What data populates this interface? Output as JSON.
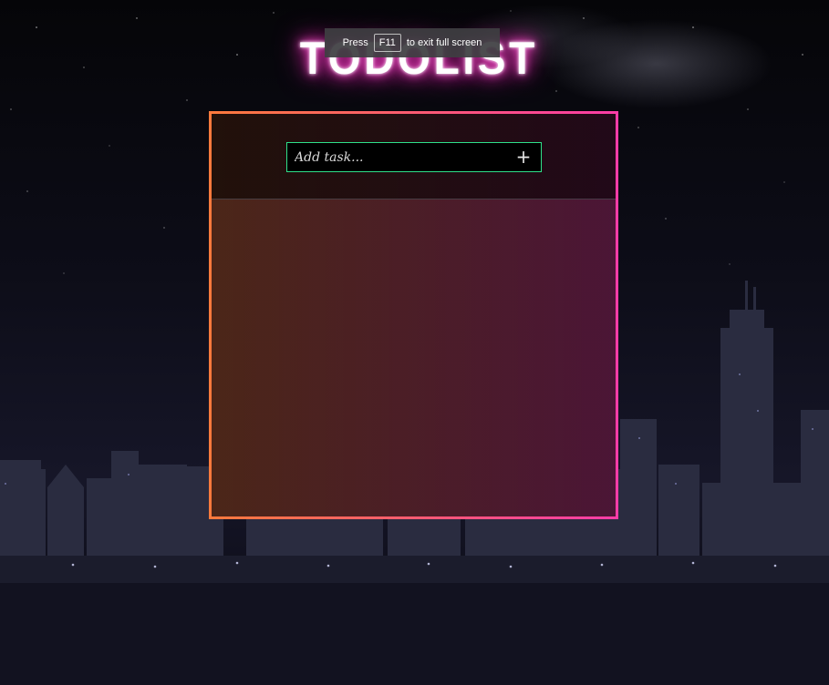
{
  "app": {
    "title": "TODOLIST"
  },
  "fullscreen_notice": {
    "prefix": "Press",
    "key": "F11",
    "suffix": "to exit full screen"
  },
  "task_form": {
    "placeholder": "Add task...",
    "add_label": "+"
  },
  "tasks": [],
  "colors": {
    "panel_border_start": "#ff7a3c",
    "panel_border_end": "#ff3ca8",
    "input_border": "#2fe08a",
    "title_glow": "#ff2bbf"
  }
}
